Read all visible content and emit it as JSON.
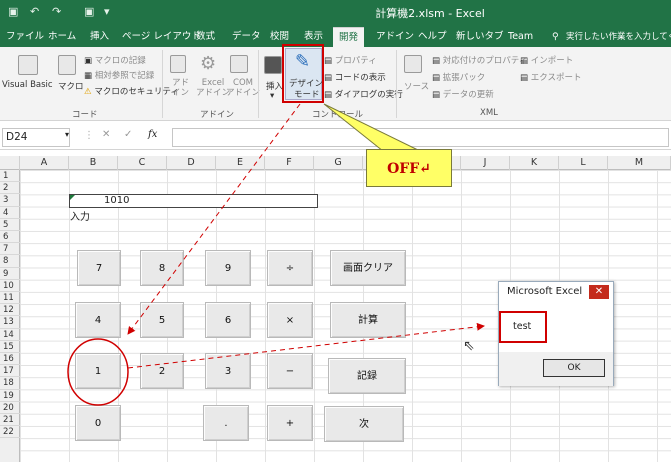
{
  "titlebar": {
    "title": "計算機2.xlsm  -  Excel",
    "undo_glyph": "↶",
    "redo_glyph": "↷",
    "save_glyph": "▣",
    "more_glyph": "▾"
  },
  "tabs": [
    {
      "label": "ファイル"
    },
    {
      "label": "ホーム"
    },
    {
      "label": "挿入"
    },
    {
      "label": "ページ レイアウト"
    },
    {
      "label": "数式"
    },
    {
      "label": "データ"
    },
    {
      "label": "校閲"
    },
    {
      "label": "表示"
    },
    {
      "label": "開発"
    },
    {
      "label": "アドイン"
    },
    {
      "label": "ヘルプ"
    },
    {
      "label": "新しいタブ"
    },
    {
      "label": "Team"
    }
  ],
  "tell_me": "実行したい作業を入力してください",
  "ribbon": {
    "visual_basic": "Visual Basic",
    "macro": "マクロ",
    "record_macro": "マクロの記録",
    "relative_ref": "相対参照で記録",
    "macro_security": "マクロのセキュリティ",
    "code_group": "コード",
    "addin": "アド\nイン",
    "excel_addin": "Excel\nアドイン",
    "com_addin": "COM\nアドイン",
    "addin_group": "アドイン",
    "insert": "挿入",
    "design_mode_1": "デザイン",
    "design_mode_2": "モード",
    "properties": "プロパティ",
    "view_code": "コードの表示",
    "run_dialog": "ダイアログの実行",
    "controls_group": "コントロール",
    "source": "ソース",
    "map_props": "対応付けのプロパティ",
    "expansion_pack": "拡張パック",
    "refresh_data": "データの更新",
    "import": "インポート",
    "export": "エクスポート",
    "xml_group": "XML"
  },
  "formula_bar": {
    "name_box": "D24",
    "cancel": "✕",
    "enter": "✓",
    "fx": "fx",
    "value": ""
  },
  "columns": [
    "A",
    "B",
    "C",
    "D",
    "E",
    "F",
    "G",
    "H",
    "I",
    "J",
    "K",
    "L",
    "M"
  ],
  "rows": [
    "1",
    "2",
    "3",
    "4",
    "5",
    "6",
    "7",
    "8",
    "9",
    "10",
    "11",
    "12",
    "13",
    "14",
    "15",
    "16",
    "17",
    "18",
    "19",
    "20",
    "21",
    "22"
  ],
  "cells": {
    "display_value": "1010",
    "input_label": "入力"
  },
  "buttons": {
    "b7": "7",
    "b8": "8",
    "b9": "9",
    "div": "÷",
    "clear": "画面クリア",
    "b4": "4",
    "b5": "5",
    "b6": "6",
    "mul": "×",
    "calc": "計算",
    "b1": "1",
    "b2": "2",
    "b3": "3",
    "sub": "−",
    "record": "記録",
    "b0": "0",
    "dot": ".",
    "add": "+",
    "next": "次"
  },
  "dialog": {
    "title": "Microsoft Excel",
    "close": "✕",
    "message": "test",
    "ok": "OK"
  },
  "callout": {
    "text": "OFF↵"
  },
  "colors": {
    "excel_green": "#217346",
    "annotation_red": "#d00000",
    "callout_yellow": "#ffff66"
  }
}
